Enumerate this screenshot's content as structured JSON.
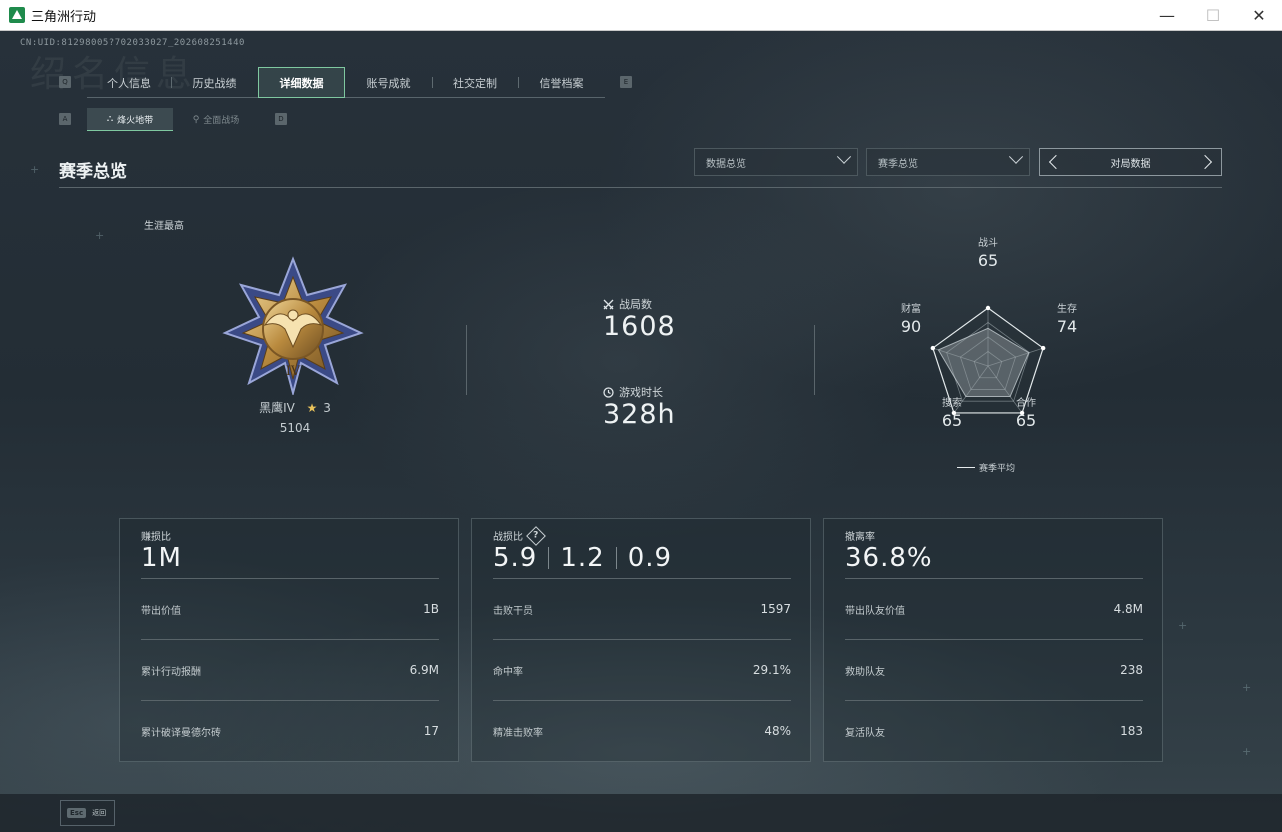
{
  "window": {
    "title": "三角洲行动"
  },
  "uid": "CN:UID:81298005?702033027_202608251440",
  "watermark": "绍名信息",
  "tabs": [
    {
      "label": "个人信息",
      "active": false
    },
    {
      "label": "历史战绩",
      "active": false
    },
    {
      "label": "详细数据",
      "active": true
    },
    {
      "label": "账号成就",
      "active": false
    },
    {
      "label": "社交定制",
      "active": false
    },
    {
      "label": "信誉档案",
      "active": false
    }
  ],
  "tab_key_left": "Q",
  "tab_key_right": "E",
  "subtabs": [
    {
      "label": "烽火地带",
      "active": true
    },
    {
      "label": "全面战场",
      "active": false
    }
  ],
  "subtab_key_left": "A",
  "subtab_key_right": "D",
  "section": {
    "title": "赛季总览"
  },
  "filters": {
    "data_overview": "数据总览",
    "season_overview": "赛季总览",
    "pager_label": "对局数据"
  },
  "career": {
    "label": "生涯最高",
    "rank_name": "黑鹰IV",
    "stars": "3",
    "score": "5104"
  },
  "stats": {
    "matches_label": "战局数",
    "matches_value": "1608",
    "playtime_label": "游戏时长",
    "playtime_value": "328h"
  },
  "radar": {
    "axes": [
      {
        "label": "战斗",
        "value": "65"
      },
      {
        "label": "生存",
        "value": "74"
      },
      {
        "label": "合作",
        "value": "65"
      },
      {
        "label": "搜索",
        "value": "65"
      },
      {
        "label": "财富",
        "value": "90"
      }
    ],
    "values": [
      65,
      74,
      65,
      65,
      90
    ],
    "max": 100,
    "legend": "赛季平均"
  },
  "cards": [
    {
      "title": "赚损比",
      "big": [
        "1M"
      ],
      "rows": [
        {
          "label": "带出价值",
          "value": "1B"
        },
        {
          "label": "累计行动报酬",
          "value": "6.9M"
        },
        {
          "label": "累计破译曼德尔砖",
          "value": "17"
        }
      ]
    },
    {
      "title": "战损比",
      "help_icon": "?",
      "big": [
        "5.9",
        "1.2",
        "0.9"
      ],
      "rows": [
        {
          "label": "击败干员",
          "value": "1597"
        },
        {
          "label": "命中率",
          "value": "29.1%"
        },
        {
          "label": "精准击败率",
          "value": "48%"
        }
      ]
    },
    {
      "title": "撤离率",
      "big": [
        "36.8%"
      ],
      "rows": [
        {
          "label": "带出队友价值",
          "value": "4.8M"
        },
        {
          "label": "救助队友",
          "value": "238"
        },
        {
          "label": "复活队友",
          "value": "183"
        }
      ]
    }
  ],
  "bottom": {
    "esc_key": "Esc",
    "back_label": "返回"
  },
  "icons": {
    "matches": "crossed-swords-icon",
    "playtime": "clock-icon",
    "app": "delta-logo-icon"
  },
  "colors": {
    "accent": "#7fc8a0",
    "gold": "#e8c25a"
  }
}
